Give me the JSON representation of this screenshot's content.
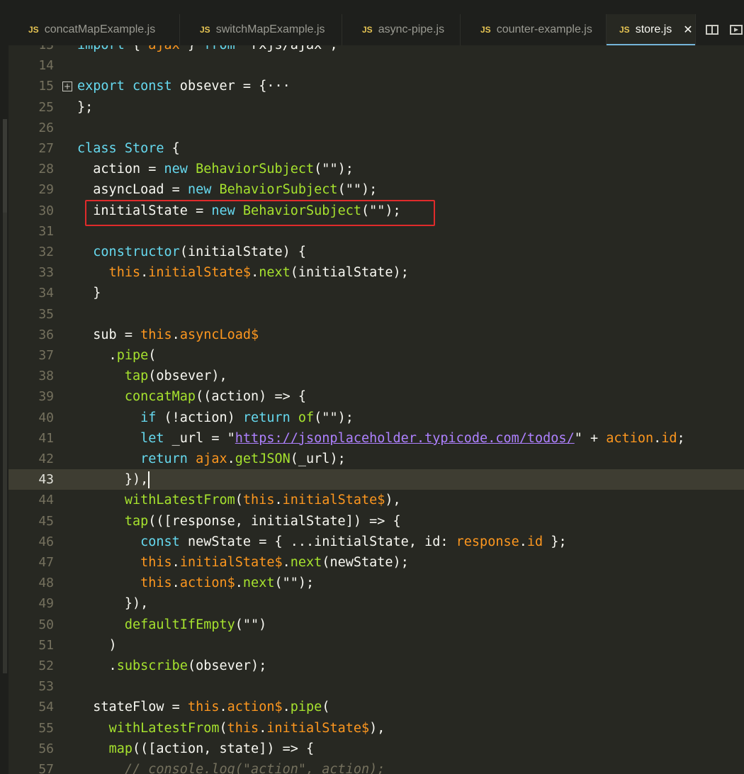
{
  "tabs": [
    {
      "icon": "JS",
      "label": "concatMapExample.js",
      "active": false
    },
    {
      "icon": "JS",
      "label": "switchMapExample.js",
      "active": false
    },
    {
      "icon": "JS",
      "label": "async-pipe.js",
      "active": false
    },
    {
      "icon": "JS",
      "label": "counter-example.js",
      "active": false
    },
    {
      "icon": "JS",
      "label": "store.js",
      "active": true,
      "close": "✕"
    }
  ],
  "tab_actions": {
    "split_icon": "split-editor-icon",
    "preview_icon": "open-preview-icon"
  },
  "editor": {
    "current_line": "43",
    "lines": [
      {
        "n": "13",
        "code": "import { ajax } from \"rxjs/ajax\";"
      },
      {
        "n": "14",
        "code": ""
      },
      {
        "n": "15",
        "code": "export const obsever = {···"
      },
      {
        "n": "25",
        "code": "};"
      },
      {
        "n": "26",
        "code": ""
      },
      {
        "n": "27",
        "code": "class Store {"
      },
      {
        "n": "28",
        "code": "  action$ = new BehaviorSubject(\"\");"
      },
      {
        "n": "29",
        "code": "  asyncLoad$ = new BehaviorSubject(\"\");"
      },
      {
        "n": "30",
        "code": "  initialState$ = new BehaviorSubject(\"\");"
      },
      {
        "n": "31",
        "code": ""
      },
      {
        "n": "32",
        "code": "  constructor(initialState) {"
      },
      {
        "n": "33",
        "code": "    this.initialState$.next(initialState);"
      },
      {
        "n": "34",
        "code": "  }"
      },
      {
        "n": "35",
        "code": ""
      },
      {
        "n": "36",
        "code": "  sub = this.asyncLoad$"
      },
      {
        "n": "37",
        "code": "    .pipe("
      },
      {
        "n": "38",
        "code": "      tap(obsever),"
      },
      {
        "n": "39",
        "code": "      concatMap((action) => {"
      },
      {
        "n": "40",
        "code": "        if (!action) return of(\"\");"
      },
      {
        "n": "41",
        "code": "        let _url = \"https://jsonplaceholder.typicode.com/todos/\" + action.id;"
      },
      {
        "n": "42",
        "code": "        return ajax.getJSON(_url);"
      },
      {
        "n": "43",
        "code": "      }),"
      },
      {
        "n": "44",
        "code": "      withLatestFrom(this.initialState$),"
      },
      {
        "n": "45",
        "code": "      tap(([response, initialState]) => {"
      },
      {
        "n": "46",
        "code": "        const newState = { ...initialState, id: response.id };"
      },
      {
        "n": "47",
        "code": "        this.initialState$.next(newState);"
      },
      {
        "n": "48",
        "code": "        this.action$.next(\"\");"
      },
      {
        "n": "49",
        "code": "      }),"
      },
      {
        "n": "50",
        "code": "      defaultIfEmpty(\"\")"
      },
      {
        "n": "51",
        "code": "    )"
      },
      {
        "n": "52",
        "code": "    .subscribe(obsever);"
      },
      {
        "n": "53",
        "code": ""
      },
      {
        "n": "54",
        "code": "  stateFlow$ = this.action$.pipe("
      },
      {
        "n": "55",
        "code": "    withLatestFrom(this.initialState$),"
      },
      {
        "n": "56",
        "code": "    map(([action, state]) => {"
      },
      {
        "n": "57",
        "code": "      // console.log(\"action\", action);"
      }
    ]
  },
  "colors": {
    "background": "#272822",
    "keyword": "#66d9ef",
    "function": "#a6e22e",
    "property": "#fd971f",
    "url": "#ae81ff",
    "highlight_box": "#e02b2b"
  }
}
